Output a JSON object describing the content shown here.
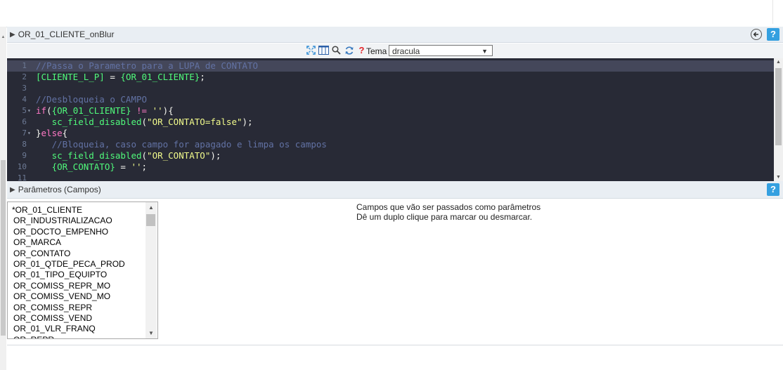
{
  "event_section": {
    "title": "OR_01_CLIENTE_onBlur",
    "help_label": "?"
  },
  "toolbar": {
    "theme_label": "Tema",
    "theme_value": "dracula",
    "icons": [
      "fullscreen-icon",
      "columns-icon",
      "search-icon",
      "refresh-icon",
      "help-icon"
    ],
    "help_glyph": "?"
  },
  "editor": {
    "lines": [
      {
        "n": "1",
        "active": true,
        "fold": "",
        "tokens": [
          {
            "c": "comment",
            "t": "//Passa o Parametro para a LUPA de CONTATO"
          }
        ]
      },
      {
        "n": "2",
        "fold": "",
        "tokens": [
          {
            "c": "var",
            "t": "[CLIENTE_L_P]"
          },
          {
            "c": "plain",
            "t": " = "
          },
          {
            "c": "var",
            "t": "{OR_01_CLIENTE}"
          },
          {
            "c": "plain",
            "t": ";"
          }
        ]
      },
      {
        "n": "3",
        "fold": "",
        "tokens": []
      },
      {
        "n": "4",
        "fold": "",
        "tokens": [
          {
            "c": "comment",
            "t": "//Desbloqueia o CAMPO"
          }
        ]
      },
      {
        "n": "5",
        "fold": "▾",
        "tokens": [
          {
            "c": "kw",
            "t": "if"
          },
          {
            "c": "plain",
            "t": "("
          },
          {
            "c": "var",
            "t": "{OR_01_CLIENTE}"
          },
          {
            "c": "plain",
            "t": " "
          },
          {
            "c": "kw",
            "t": "!="
          },
          {
            "c": "plain",
            "t": " "
          },
          {
            "c": "str",
            "t": "''"
          },
          {
            "c": "plain",
            "t": "){"
          }
        ]
      },
      {
        "n": "6",
        "fold": "",
        "tokens": [
          {
            "c": "plain",
            "t": "   "
          },
          {
            "c": "var",
            "t": "sc_field_disabled"
          },
          {
            "c": "plain",
            "t": "("
          },
          {
            "c": "str",
            "t": "\"OR_CONTATO=false\""
          },
          {
            "c": "plain",
            "t": ");"
          }
        ]
      },
      {
        "n": "7",
        "fold": "▾",
        "tokens": [
          {
            "c": "plain",
            "t": "}"
          },
          {
            "c": "kw",
            "t": "else"
          },
          {
            "c": "plain",
            "t": "{"
          }
        ]
      },
      {
        "n": "8",
        "fold": "",
        "tokens": [
          {
            "c": "plain",
            "t": "   "
          },
          {
            "c": "comment",
            "t": "//Bloqueia, caso campo for apagado e limpa os campos"
          }
        ]
      },
      {
        "n": "9",
        "fold": "",
        "tokens": [
          {
            "c": "plain",
            "t": "   "
          },
          {
            "c": "var",
            "t": "sc_field_disabled"
          },
          {
            "c": "plain",
            "t": "("
          },
          {
            "c": "str",
            "t": "\"OR_CONTATO\""
          },
          {
            "c": "plain",
            "t": ");"
          }
        ]
      },
      {
        "n": "10",
        "fold": "",
        "tokens": [
          {
            "c": "plain",
            "t": "   "
          },
          {
            "c": "var",
            "t": "{OR_CONTATO}"
          },
          {
            "c": "plain",
            "t": " = "
          },
          {
            "c": "str",
            "t": "''"
          },
          {
            "c": "plain",
            "t": ";"
          }
        ]
      },
      {
        "n": "11",
        "fold": "",
        "tokens": []
      }
    ]
  },
  "params_section": {
    "title": "Parâmetros (Campos)",
    "help_label": "?",
    "fields": [
      "*OR_01_CLIENTE",
      "OR_INDUSTRIALIZACAO",
      "OR_DOCTO_EMPENHO",
      "OR_MARCA",
      "OR_CONTATO",
      "OR_01_QTDE_PECA_PROD",
      "OR_01_TIPO_EQUIPTO",
      "OR_COMISS_REPR_MO",
      "OR_COMISS_VEND_MO",
      "OR_COMISS_REPR",
      "OR_COMISS_VEND",
      "OR_01_VLR_FRANQ",
      "OR_REPR"
    ],
    "info_line1": "Campos que vão ser passados como parâmetros",
    "info_line2": "Dê um duplo clique para marcar ou desmarcar."
  },
  "colors": {
    "editor_bg": "#282a36",
    "comment": "#6272a4",
    "variable": "#50fa7b",
    "string": "#f1fa8c",
    "keyword": "#ff79c6",
    "help_button": "#34a0e0"
  }
}
